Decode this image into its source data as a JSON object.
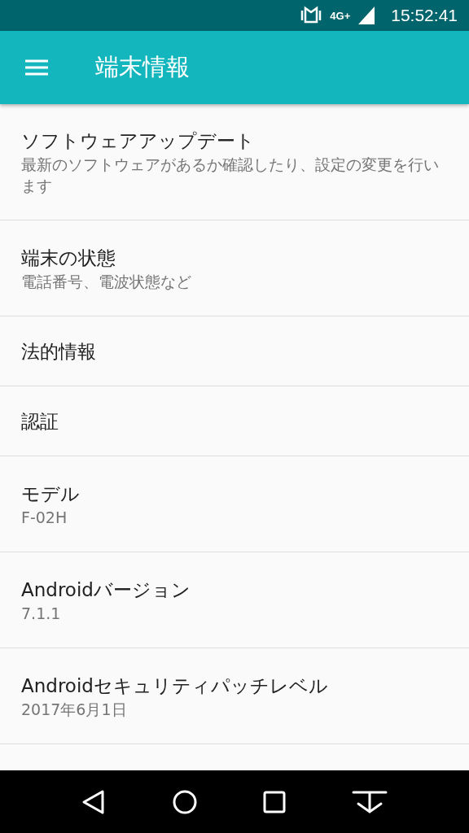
{
  "status_bar": {
    "network": "4G+",
    "time": "15:52:41"
  },
  "app_bar": {
    "title": "端末情報"
  },
  "items": [
    {
      "title": "ソフトウェアアップデート",
      "summary": "最新のソフトウェアがあるか確認したり、設定の変更を行います"
    },
    {
      "title": "端末の状態",
      "summary": "電話番号、電波状態など"
    },
    {
      "title": "法的情報"
    },
    {
      "title": "認証"
    },
    {
      "title": "モデル",
      "summary": "F-02H"
    },
    {
      "title": "Androidバージョン",
      "summary": "7.1.1"
    },
    {
      "title": "Androidセキュリティパッチレベル",
      "summary": "2017年6月1日"
    }
  ]
}
